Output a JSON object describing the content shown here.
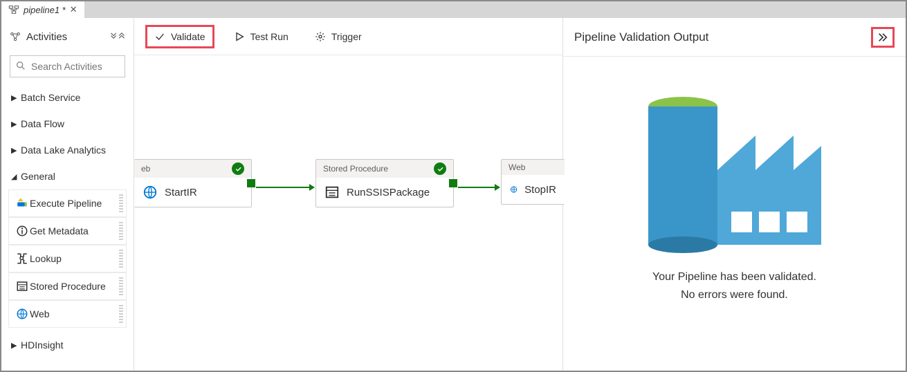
{
  "tab": {
    "title": "pipeline1 *"
  },
  "sidebar": {
    "title": "Activities",
    "searchPlaceholder": "Search Activities",
    "groups": [
      {
        "label": "Batch Service",
        "expanded": false
      },
      {
        "label": "Data Flow",
        "expanded": false
      },
      {
        "label": "Data Lake Analytics",
        "expanded": false
      },
      {
        "label": "General",
        "expanded": true
      },
      {
        "label": "HDInsight",
        "expanded": false
      }
    ],
    "general_items": [
      {
        "label": "Execute Pipeline",
        "icon": "exec"
      },
      {
        "label": "Get Metadata",
        "icon": "info"
      },
      {
        "label": "Lookup",
        "icon": "lookup"
      },
      {
        "label": "Stored Procedure",
        "icon": "sproc"
      },
      {
        "label": "Web",
        "icon": "web"
      }
    ]
  },
  "toolbar": {
    "validate": "Validate",
    "testrun": "Test Run",
    "trigger": "Trigger"
  },
  "nodes": {
    "n1": {
      "type": "eb",
      "name": "StartIR"
    },
    "n2": {
      "type": "Stored Procedure",
      "name": "RunSSISPackage"
    },
    "n3": {
      "type": "Web",
      "name": "StopIR"
    }
  },
  "panel": {
    "title": "Pipeline Validation Output",
    "msg1": "Your Pipeline has been validated.",
    "msg2": "No errors were found."
  }
}
